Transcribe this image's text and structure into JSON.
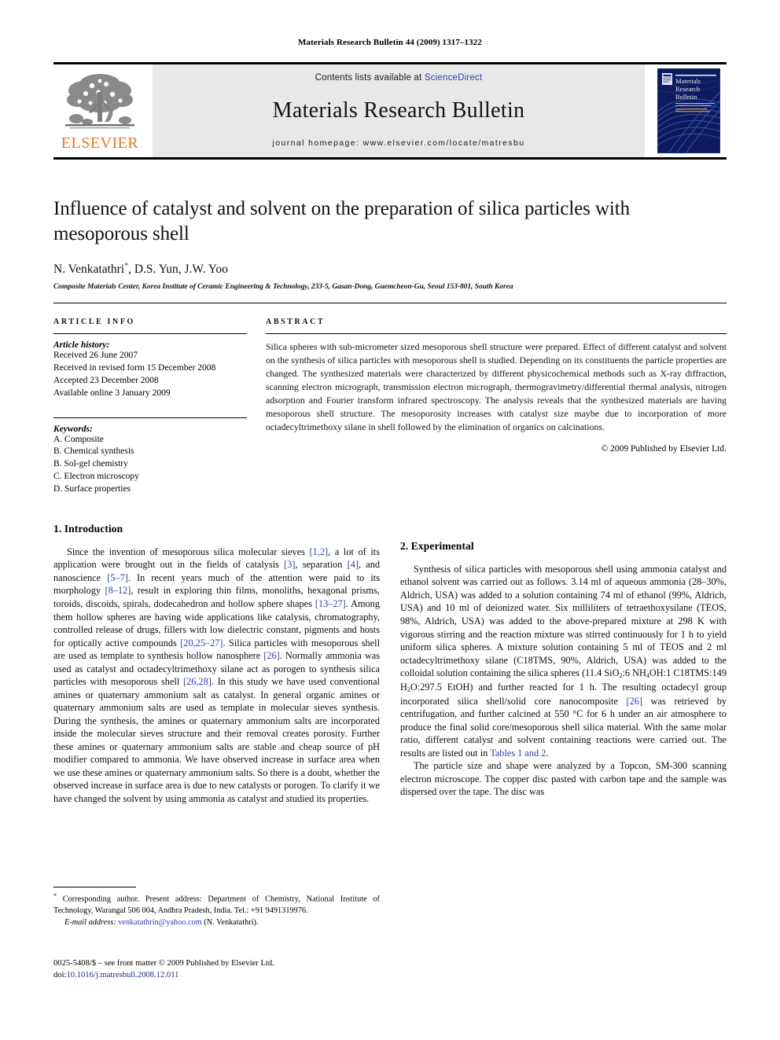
{
  "running_head": "Materials Research Bulletin 44 (2009) 1317–1322",
  "masthead": {
    "contents_prefix": "Contents lists available at ",
    "sciencedirect": "ScienceDirect",
    "journal_title": "Materials Research Bulletin",
    "homepage": "journal homepage: www.elsevier.com/locate/matresbu",
    "publisher_wordmark": "ELSEVIER",
    "cover_title_line1": "Materials",
    "cover_title_line2": "Research",
    "cover_title_line3": "Bulletin",
    "accent_orange": "#E87722",
    "link_blue": "#2b40b0"
  },
  "article": {
    "title": "Influence of catalyst and solvent on the preparation of silica particles with mesoporous shell",
    "authors": "N. Venkatathri",
    "authors_rest": ", D.S. Yun, J.W. Yoo",
    "corresponding_marker": "*",
    "affiliation": "Composite Materials Center, Korea Institute of Ceramic Engineering & Technology, 233-5, Gasan-Dong, Guemcheon-Gu, Seoul 153-801, South Korea"
  },
  "article_info": {
    "heading": "ARTICLE INFO",
    "history_label": "Article history:",
    "history": [
      "Received 26 June 2007",
      "Received in revised form 15 December 2008",
      "Accepted 23 December 2008",
      "Available online 3 January 2009"
    ],
    "keywords_label": "Keywords:",
    "keywords": [
      "A. Composite",
      "B. Chemical synthesis",
      "B. Sol-gel chemistry",
      "C. Electron microscopy",
      "D. Surface properties"
    ]
  },
  "abstract": {
    "heading": "ABSTRACT",
    "text": "Silica spheres with sub-micrometer sized mesoporous shell structure were prepared. Effect of different catalyst and solvent on the synthesis of silica particles with mesoporous shell is studied. Depending on its constituents the particle properties are changed. The synthesized materials were characterized by different physicochemical methods such as X-ray diffraction, scanning electron micrograph, transmission electron micrograph, thermogravimetry/differential thermal analysis, nitrogen adsorption and Fourier transform infrared spectroscopy. The analysis reveals that the synthesized materials are having mesoporous shell structure. The mesoporosity increases with catalyst size maybe due to incorporation of more octadecyltrimethoxy silane in shell followed by the elimination of organics on calcinations.",
    "copyright": "© 2009 Published by Elsevier Ltd."
  },
  "sections": {
    "introduction_heading": "1. Introduction",
    "intro_p1_a": "Since the invention of mesoporous silica molecular sieves ",
    "intro_ref1": "[1,2]",
    "intro_p1_b": ", a lot of its application were brought out in the fields of catalysis ",
    "intro_ref2": "[3]",
    "intro_p1_c": ", separation ",
    "intro_ref3": "[4]",
    "intro_p1_d": ", and nanoscience ",
    "intro_ref4": "[5–7]",
    "intro_p1_e": ". In recent years much of the attention were paid to its morphology ",
    "intro_ref5": "[8–12]",
    "intro_p1_f": ", result in exploring thin films, monoliths, hexagonal prisms, toroids, discoids, spirals, dodecahedron and hollow sphere shapes ",
    "intro_ref6": "[13–27]",
    "intro_p1_g": ". Among them hollow spheres are having wide applications like catalysis, chromatography, controlled release of drugs, fillers with low dielectric constant, pigments and hosts for optically active compounds ",
    "intro_ref7": "[20,25–27]",
    "intro_p1_h": ". Silica particles with mesoporous shell are used as template to synthesis hollow nanosphere ",
    "intro_ref8": "[26]",
    "intro_p1_i": ". Normally ammonia was used as catalyst and octadecyltrimethoxy silane act as porogen to synthesis silica particles with mesoporous shell ",
    "intro_ref9": "[26,28]",
    "intro_p1_j": ". In this study we have used conventional amines or quaternary ammonium salt as catalyst. In general organic amines or quaternary ammonium salts are used as template in molecular sieves synthesis. During the synthesis, the amines or quaternary ammonium salts are incorporated inside the molecular sieves structure and their removal creates porosity. Further these amines or quaternary ammonium salts are stable and cheap source of pH modifier compared to ammonia. We have observed increase in surface area when we use these amines or quaternary ammonium salts. So there is a doubt, whether the observed increase in surface area is due to new catalysts or porogen. To clarify it we have changed the solvent by using ammonia as catalyst and studied its properties.",
    "experimental_heading": "2. Experimental",
    "exp_p1_a": "Synthesis of silica particles with mesoporous shell using ammonia catalyst and ethanol solvent was carried out as follows. 3.14 ml of aqueous ammonia (28–30%, Aldrich, USA) was added to a solution containing 74 ml of ethanol (99%, Aldrich, USA) and 10 ml of deionized water. Six milliliters of tetraethoxysilane (TEOS, 98%, Aldrich, USA) was added to the above-prepared mixture at 298 K with vigorous stirring and the reaction mixture was stirred continuously for 1 h to yield uniform silica spheres. A mixture solution containing 5 ml of TEOS and 2 ml octadecyltrimethoxy silane (C18TMS, 90%, Aldrich, USA) was added to the colloidal solution containing the silica spheres (11.4 SiO",
    "exp_sub1": "2",
    "exp_p1_b": ":6 NH",
    "exp_sub2": "4",
    "exp_p1_c": "OH:1 C18TMS:149 H",
    "exp_sub3": "2",
    "exp_p1_d": "O:297.5 EtOH) and further reacted for 1 h. The resulting octadecyl group incorporated silica shell/solid core nanocomposite ",
    "exp_ref1": "[26]",
    "exp_p1_e": " was retrieved by centrifugation, and further calcined at 550 °C for 6 h under an air atmosphere to produce the final solid core/mesoporous shell silica material. With the same molar ratio, different catalyst and solvent containing reactions were carried out. The results are listed out in ",
    "exp_tables_link": "Tables 1 and 2",
    "exp_p1_f": ".",
    "exp_p2": "The particle size and shape were analyzed by a Topcon, SM-300 scanning electron microscope. The copper disc pasted with carbon tape and the sample was dispersed over the tape. The disc was"
  },
  "footnote": {
    "star": "*",
    "text": " Corresponding author. Present address: Department of Chemistry, National Institute of Technology, Warangal 506 004, Andhra Pradesh, India. Tel.: +91 9491319976.",
    "email_label": "E-mail address:",
    "email": "venkatathrin@yahoo.com",
    "email_suffix": " (N. Venkatathri)."
  },
  "imprint": {
    "line1": "0025-5408/$ – see front matter © 2009 Published by Elsevier Ltd.",
    "doi_label": "doi:",
    "doi": "10.1016/j.matresbull.2008.12.011"
  }
}
